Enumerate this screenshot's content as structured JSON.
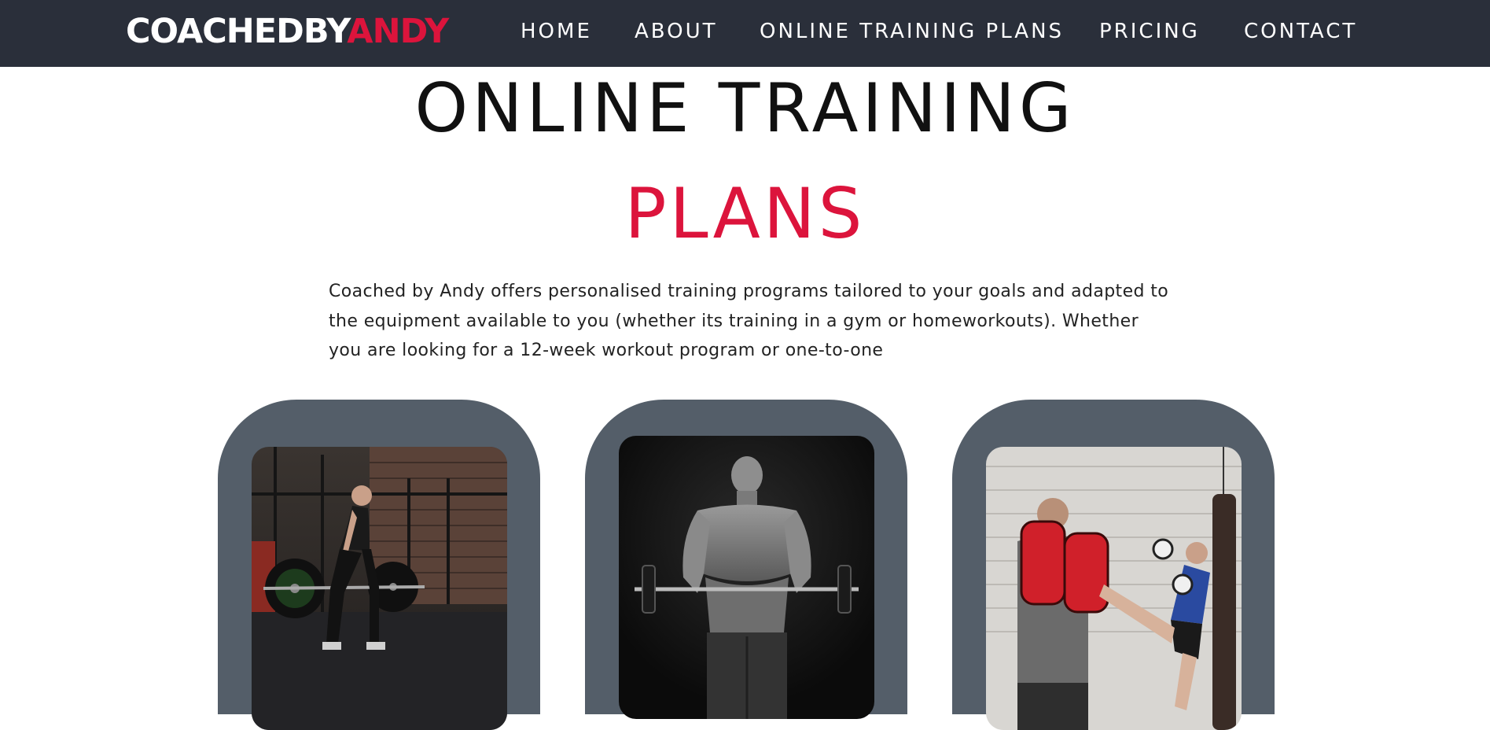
{
  "nav": {
    "logo_main": "COACHEDBY",
    "logo_accent": "ANDY",
    "items": [
      "HOME",
      "ABOUT",
      "ONLINE TRAINING PLANS",
      "PRICING",
      "CONTACT"
    ]
  },
  "hero": {
    "title_line1": "ONLINE TRAINING",
    "title_line2": "PLANS",
    "intro": "Coached by Andy offers personalised training programs tailored to your goals and adapted to the equipment available to you (whether its training in a gym or homeworkouts). Whether you are looking for a 12-week workout program or one-to-one"
  },
  "colors": {
    "nav_bg": "#2a2f3a",
    "accent": "#dc143c",
    "card_bg": "#545e69"
  },
  "cards": [
    {
      "image": "woman-deadlift-photo"
    },
    {
      "image": "man-barbell-curl-photo"
    },
    {
      "image": "kickboxing-pads-photo"
    }
  ]
}
